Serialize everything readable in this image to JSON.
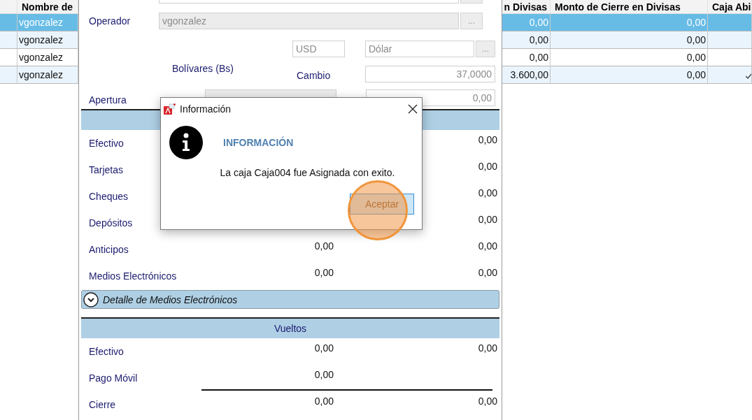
{
  "table": {
    "columns": [
      {
        "label": "Nombre de"
      },
      {
        "label": "n Divisas"
      },
      {
        "label": "Monto de Cierre en Divisas"
      },
      {
        "label": "Caja Abi"
      }
    ],
    "rows": [
      {
        "selected": true,
        "open": false,
        "cells": [
          "vgonzalez",
          "0,00",
          "0,00"
        ]
      },
      {
        "selected": false,
        "open": false,
        "cells": [
          "vgonzalez",
          "0,00",
          "0,00"
        ]
      },
      {
        "selected": false,
        "open": false,
        "cells": [
          "vgonzalez",
          "0,00",
          "0,00"
        ]
      },
      {
        "selected": false,
        "open": true,
        "cells": [
          "vgonzalez",
          "3.600,00",
          "0,00"
        ]
      }
    ]
  },
  "form": {
    "operator": {
      "label": "Operador",
      "value": "vgonzalez",
      "button": "..."
    },
    "currency": {
      "code": "USD",
      "name": "Dólar",
      "button": "..."
    },
    "local_currency": "Bolívares (Bs)",
    "rate": {
      "label": "Cambio",
      "value": "37,0000"
    },
    "opening": {
      "label": "Apertura",
      "foreign": "0,00"
    },
    "payments": [
      {
        "label": "Efectivo",
        "foreign": "0,00"
      },
      {
        "label": "Tarjetas",
        "foreign": "0,00"
      },
      {
        "label": "Cheques",
        "foreign": "0,00"
      },
      {
        "label": "Depósitos",
        "foreign": "0,00"
      },
      {
        "label": "Anticipos",
        "local": "0,00",
        "foreign": "0,00"
      },
      {
        "label": "Medios Electrónicos",
        "local": "0,00",
        "foreign": "0,00"
      }
    ],
    "detail": {
      "label": "Detalle de Medios Electrónicos"
    },
    "change": {
      "title": "Vueltos",
      "rows": [
        {
          "label": "Efectivo",
          "local": "0,00",
          "foreign": "0,00"
        },
        {
          "label": "Pago Móvil",
          "local": "0,00"
        }
      ]
    },
    "closing": {
      "label": "Cierre",
      "local": "0,00",
      "foreign": "0,00"
    }
  },
  "dialog": {
    "title": "Información",
    "heading": "INFORMACIÓN",
    "message": "La caja Caja004 fue Asignada con exito.",
    "button": "Aceptar"
  }
}
